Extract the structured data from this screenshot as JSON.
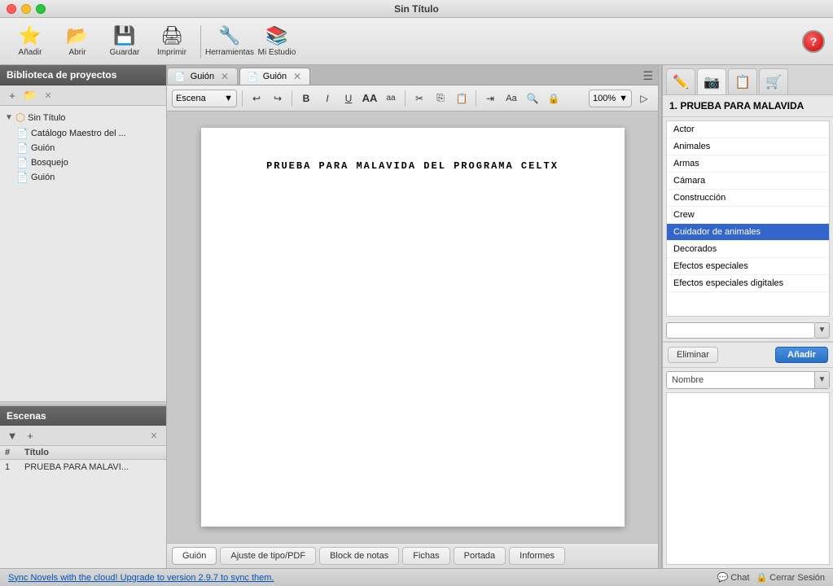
{
  "window": {
    "title": "Sin Título"
  },
  "toolbar": {
    "buttons": [
      {
        "id": "add",
        "icon": "⭐",
        "label": "Añadir"
      },
      {
        "id": "open",
        "icon": "📁",
        "label": "Abrir"
      },
      {
        "id": "save",
        "icon": "💾",
        "label": "Guardar"
      },
      {
        "id": "print",
        "icon": "🖨",
        "label": "Imprimir"
      },
      {
        "id": "tools",
        "icon": "🔧",
        "label": "Herramientas"
      },
      {
        "id": "mystudio",
        "icon": "📚",
        "label": "Mi Estudio"
      }
    ]
  },
  "sidebar": {
    "header": "Biblioteca de proyectos",
    "tree": {
      "root": "Sin Título",
      "items": [
        {
          "id": "catalogo",
          "label": "Catálogo Maestro del ...",
          "type": "doc"
        },
        {
          "id": "guion1",
          "label": "Guión",
          "type": "doc"
        },
        {
          "id": "bosquejo",
          "label": "Bosquejo",
          "type": "doc"
        },
        {
          "id": "guion2",
          "label": "Guión",
          "type": "doc"
        }
      ]
    }
  },
  "scenes": {
    "header": "Escenas",
    "columns": {
      "num": "#",
      "title": "Título"
    },
    "rows": [
      {
        "num": "1",
        "title": "PRUEBA PARA MALAVI..."
      }
    ]
  },
  "tabs": [
    {
      "id": "tab1",
      "label": "Guión",
      "active": false
    },
    {
      "id": "tab2",
      "label": "Guión",
      "active": true
    }
  ],
  "format_bar": {
    "style_select": "Escena",
    "zoom": "100%",
    "buttons": [
      "B",
      "I",
      "U",
      "AA",
      "aa"
    ]
  },
  "script": {
    "content": "PRUEBA PARA MALAVIDA DEL PROGRAMA CELTX"
  },
  "bottom_tabs": [
    {
      "id": "guion",
      "label": "Guión",
      "active": true
    },
    {
      "id": "ajuste",
      "label": "Ajuste de tipo/PDF",
      "active": false
    },
    {
      "id": "block",
      "label": "Block de notas",
      "active": false
    },
    {
      "id": "fichas",
      "label": "Fichas",
      "active": false
    },
    {
      "id": "portada",
      "label": "Portada",
      "active": false
    },
    {
      "id": "informes",
      "label": "Informes",
      "active": false
    }
  ],
  "right_panel": {
    "section_title": "1. PRUEBA PARA MALAVIDA",
    "tabs": [
      {
        "id": "pencil",
        "icon": "✏️"
      },
      {
        "id": "camera",
        "icon": "📷"
      },
      {
        "id": "doc",
        "icon": "📋"
      },
      {
        "id": "cart",
        "icon": "🛒"
      }
    ],
    "categories": [
      "Actor",
      "Animales",
      "Armas",
      "Cámara",
      "Construcción",
      "Crew",
      "Cuidador de animales",
      "Decorados",
      "Efectos especiales",
      "Efectos especiales digitales"
    ],
    "selected_category": "Cuidador de animales",
    "nombre_label": "Nombre",
    "buttons": {
      "delete": "Eliminar",
      "add": "Añadir"
    }
  },
  "status_bar": {
    "upgrade_text": "Sync Novels with the cloud! Upgrade to version 2.9.7 to sync them.",
    "chat_label": "Chat",
    "session_label": "Cerrar Sesión"
  }
}
